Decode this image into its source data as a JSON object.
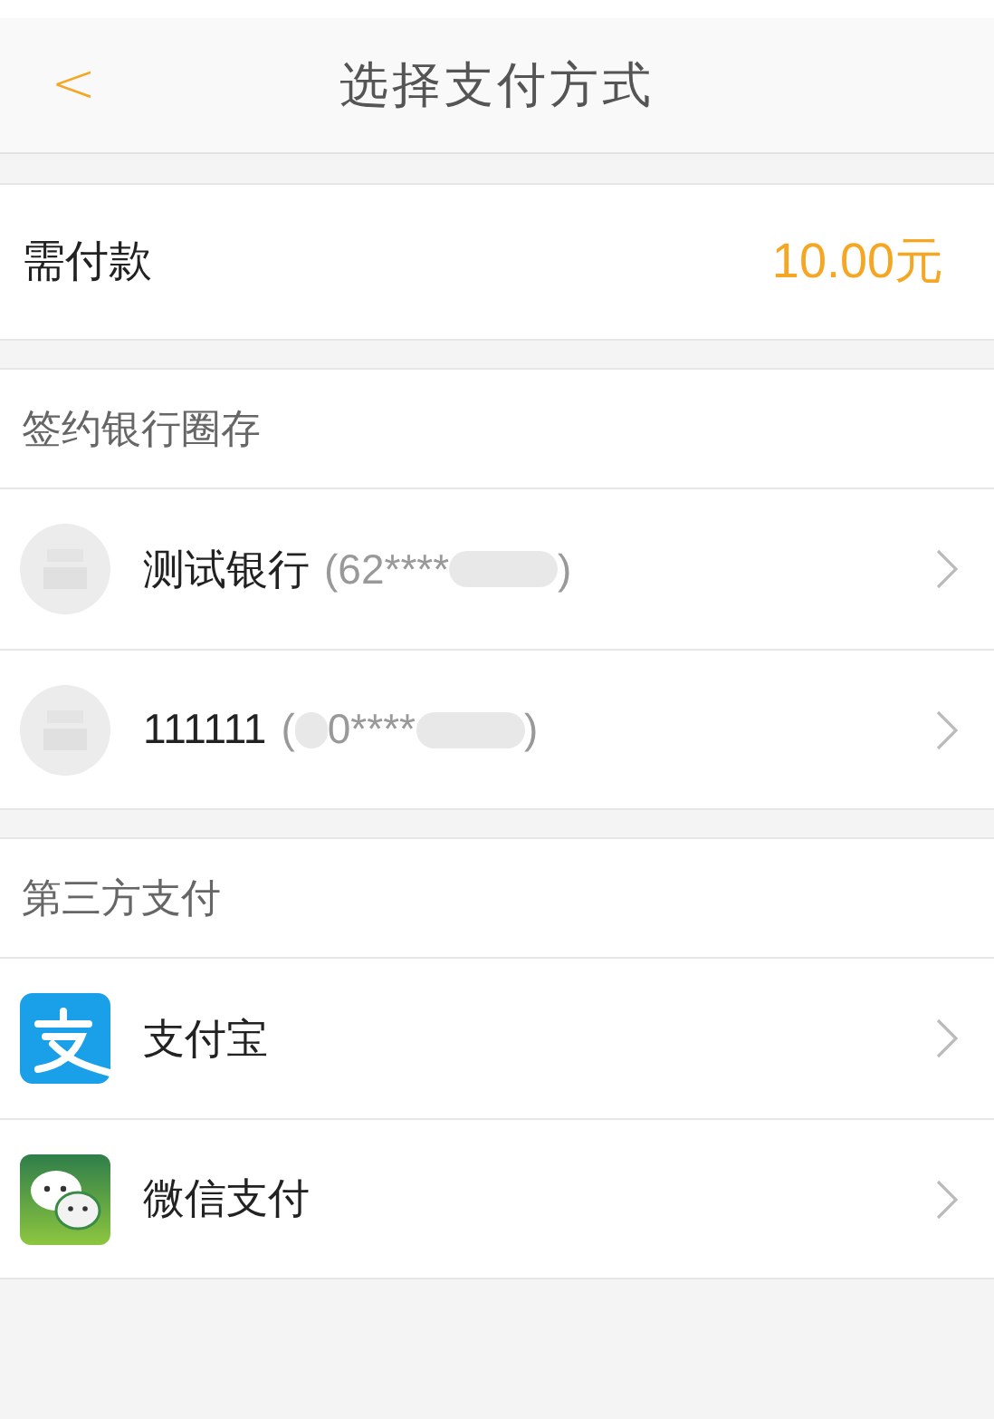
{
  "nav": {
    "back": "<",
    "title": "选择支付方式"
  },
  "payment": {
    "label": "需付款",
    "amount": "10.00元"
  },
  "sections": [
    {
      "title": "签约银行圈存",
      "items": [
        {
          "kind": "bank",
          "name": "测试银行",
          "number_parts": [
            "(62****",
            ")"
          ]
        },
        {
          "kind": "bank",
          "name": "111111",
          "number_parts": [
            "(",
            "0****",
            ")"
          ]
        }
      ]
    },
    {
      "title": "第三方支付",
      "items": [
        {
          "kind": "alipay",
          "name": "支付宝"
        },
        {
          "kind": "wechat",
          "name": "微信支付"
        }
      ]
    }
  ]
}
